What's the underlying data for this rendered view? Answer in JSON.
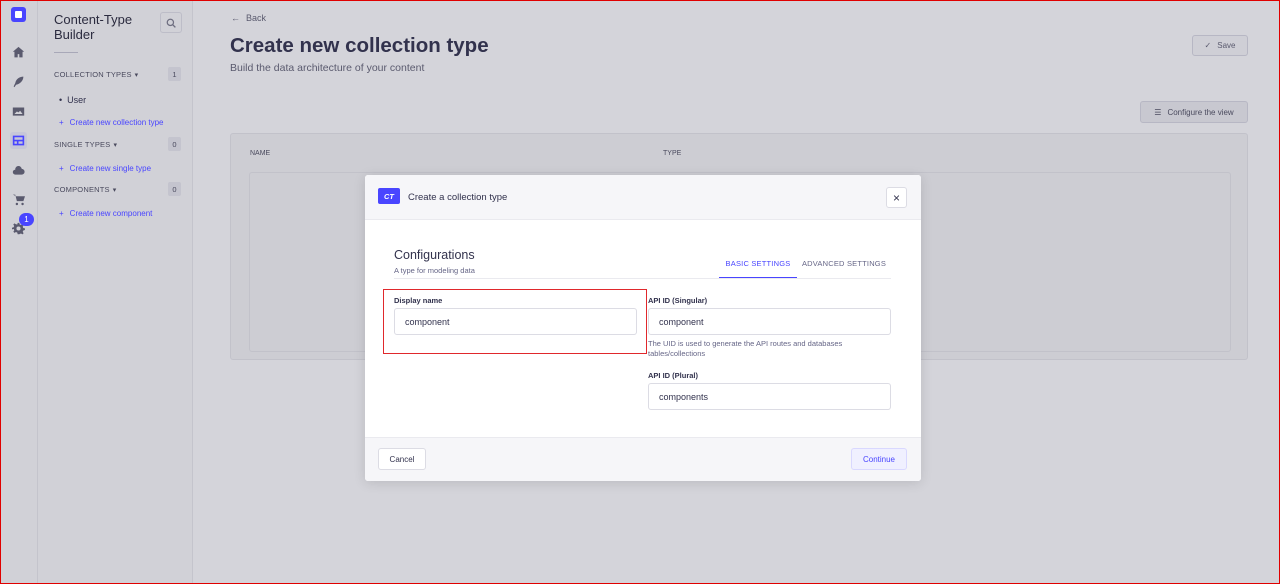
{
  "rail": {
    "items": [
      {
        "icon": "home-icon"
      },
      {
        "icon": "feather-icon"
      },
      {
        "icon": "media-library-icon"
      },
      {
        "icon": "content-type-builder-icon"
      },
      {
        "icon": "cloud-icon"
      },
      {
        "icon": "cart-icon"
      },
      {
        "icon": "settings-icon"
      }
    ],
    "settings_badge": "1"
  },
  "sidebar": {
    "title": "Content-Type Builder",
    "collection_types": {
      "label": "COLLECTION TYPES",
      "count": "1",
      "items": [
        "User"
      ],
      "create_link": "Create new collection type"
    },
    "single_types": {
      "label": "SINGLE TYPES",
      "count": "0",
      "create_link": "Create new single type"
    },
    "components": {
      "label": "COMPONENTS",
      "count": "0",
      "create_link": "Create new component"
    }
  },
  "header": {
    "back": "Back",
    "title": "Create new collection type",
    "subtitle": "Build the data architecture of your content",
    "save": "Save",
    "configure_view": "Configure the view"
  },
  "table": {
    "columns": [
      "NAME",
      "TYPE"
    ]
  },
  "modal": {
    "badge": "CT",
    "title": "Create a collection type",
    "section_title": "Configurations",
    "section_subtitle": "A type for modeling data",
    "tabs": [
      "BASIC SETTINGS",
      "ADVANCED SETTINGS"
    ],
    "display_name": {
      "label": "Display name",
      "value": "component"
    },
    "api_singular": {
      "label": "API ID (Singular)",
      "value": "component",
      "hint": "The UID is used to generate the API routes and databases tables/collections"
    },
    "api_plural": {
      "label": "API ID (Plural)",
      "value": "components"
    },
    "cancel": "Cancel",
    "continue": "Continue"
  },
  "colors": {
    "primary": "#4945ff",
    "highlight": "#e0282c"
  }
}
